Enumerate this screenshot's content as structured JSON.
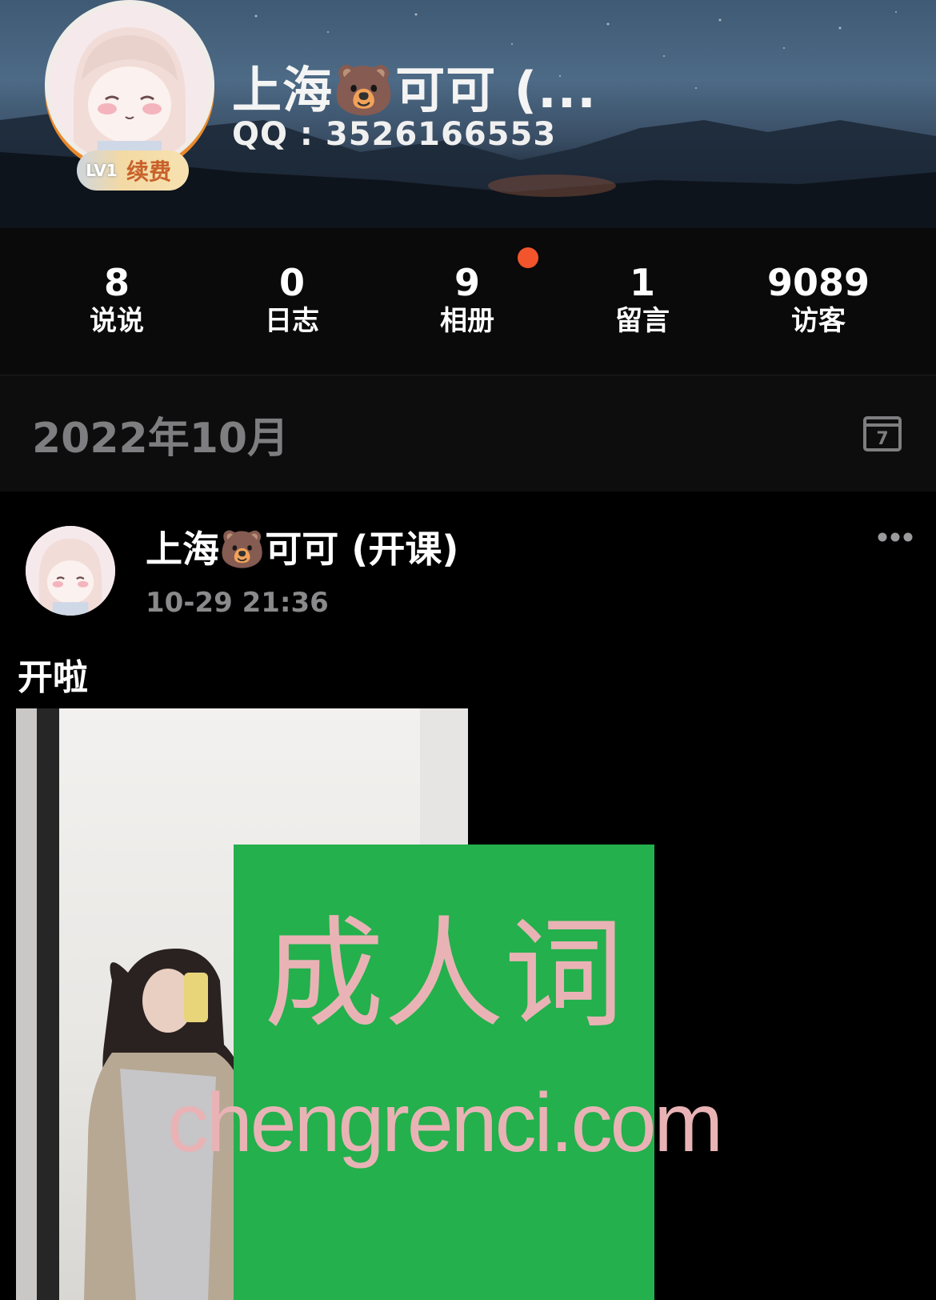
{
  "profile": {
    "name": "上海🐻可可 (...",
    "qq": "QQ : 3526166553",
    "level": "LV1",
    "renew_label": "续费"
  },
  "stats": [
    {
      "value": "8",
      "label": "说说"
    },
    {
      "value": "0",
      "label": "日志"
    },
    {
      "value": "9",
      "label": "相册",
      "has_new_dot": true
    },
    {
      "value": "1",
      "label": "留言"
    },
    {
      "value": "9089",
      "label": "访客"
    }
  ],
  "timeline": {
    "month": "2022年10月",
    "calendar_icon": "calendar-icon",
    "calendar_day": "7"
  },
  "post": {
    "author": "上海🐻可可 (开课)",
    "time": "10-29 21:36",
    "text": "开啦",
    "more_icon": "more-horizontal-icon"
  },
  "ad_overlay": {
    "line1": "成人词",
    "line2": "chengrenci.com"
  },
  "colors": {
    "accent_dot": "#f2552c",
    "muted_text": "#8a8a8c",
    "ad_background": "#24b04c",
    "ad_text": "#e9b3b6",
    "renew_text": "#c8612a"
  }
}
